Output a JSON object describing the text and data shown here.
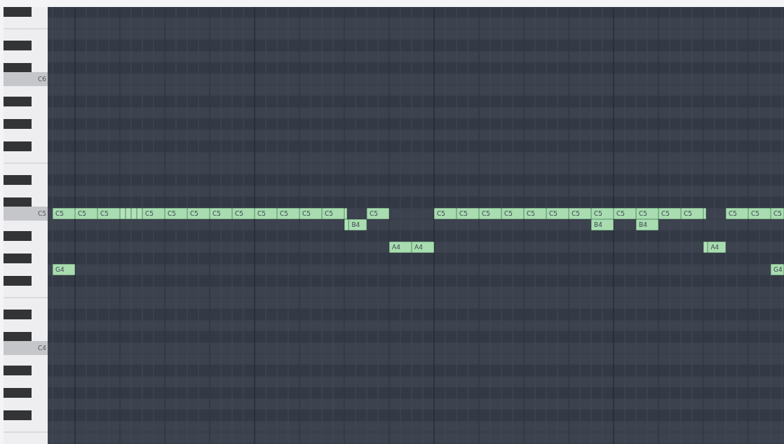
{
  "keyboard": {
    "octave_labels": [
      {
        "label": "C6"
      },
      {
        "label": "C5"
      },
      {
        "label": "C4"
      }
    ]
  },
  "notes": [
    {
      "kind": "labeled",
      "label": "C5"
    },
    {
      "kind": "labeled",
      "label": "C5"
    },
    {
      "kind": "labeled",
      "label": "C5"
    },
    {
      "kind": "short"
    },
    {
      "kind": "short"
    },
    {
      "kind": "short"
    },
    {
      "kind": "short"
    },
    {
      "kind": "labeled",
      "label": "C5"
    },
    {
      "kind": "labeled",
      "label": "C5"
    },
    {
      "kind": "labeled",
      "label": "C5"
    },
    {
      "kind": "labeled",
      "label": "C5"
    },
    {
      "kind": "labeled",
      "label": "C5"
    },
    {
      "kind": "labeled",
      "label": "C5"
    },
    {
      "kind": "labeled",
      "label": "C5"
    },
    {
      "kind": "labeled",
      "label": "C5"
    },
    {
      "kind": "labeled",
      "label": "C5"
    },
    {
      "kind": "short"
    },
    {
      "kind": "labeled",
      "label": "C5"
    },
    {
      "kind": "labeled",
      "label": "C5"
    },
    {
      "kind": "labeled",
      "label": "C5"
    },
    {
      "kind": "labeled",
      "label": "C5"
    },
    {
      "kind": "labeled",
      "label": "C5"
    },
    {
      "kind": "labeled",
      "label": "C5"
    },
    {
      "kind": "labeled",
      "label": "C5"
    },
    {
      "kind": "labeled",
      "label": "C5"
    },
    {
      "kind": "labeled",
      "label": "C5"
    },
    {
      "kind": "labeled",
      "label": "C5"
    },
    {
      "kind": "labeled",
      "label": "C5"
    },
    {
      "kind": "labeled",
      "label": "C5"
    },
    {
      "kind": "labeled",
      "label": "C5"
    },
    {
      "kind": "short"
    },
    {
      "kind": "labeled",
      "label": "C5"
    },
    {
      "kind": "labeled",
      "label": "C5"
    },
    {
      "kind": "labeled",
      "label": "C5"
    },
    {
      "kind": "short"
    },
    {
      "kind": "labeled",
      "label": "B4"
    },
    {
      "kind": "labeled",
      "label": "B4"
    },
    {
      "kind": "labeled",
      "label": "B4"
    },
    {
      "kind": "labeled",
      "label": "A4"
    },
    {
      "kind": "labeled",
      "label": "A4"
    },
    {
      "kind": "short"
    },
    {
      "kind": "labeled",
      "label": "A4"
    },
    {
      "kind": "labeled",
      "label": "G4"
    },
    {
      "kind": "labeled",
      "label": "G4"
    }
  ]
}
